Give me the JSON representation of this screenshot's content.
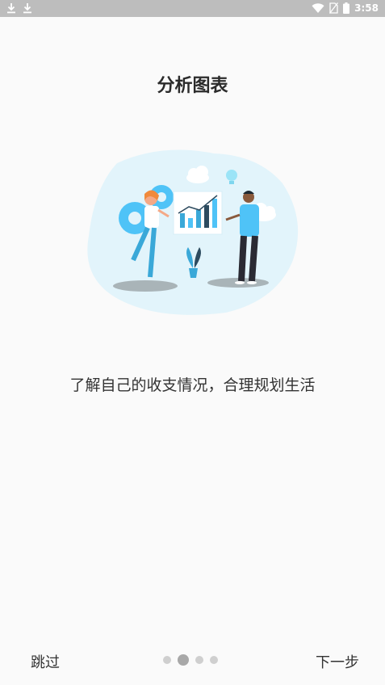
{
  "status_bar": {
    "time": "3:58",
    "left_icons": [
      "download-icon",
      "download-icon"
    ],
    "right_icons": [
      "wifi-icon",
      "no-sim-icon",
      "battery-icon"
    ]
  },
  "onboarding": {
    "title": "分析图表",
    "subtitle": "了解自己的收支情况，合理规划生活",
    "illustration": "analytics-chart-illustration",
    "page_index": 2,
    "page_count": 4
  },
  "footer": {
    "skip_label": "跳过",
    "next_label": "下一步"
  },
  "colors": {
    "status_bar_bg": "#bdbdbd",
    "background": "#fafafa",
    "text": "#333333",
    "dot_active": "#a8a8a8",
    "dot_inactive": "#cfcfcf",
    "accent": "#4fc3f7"
  }
}
